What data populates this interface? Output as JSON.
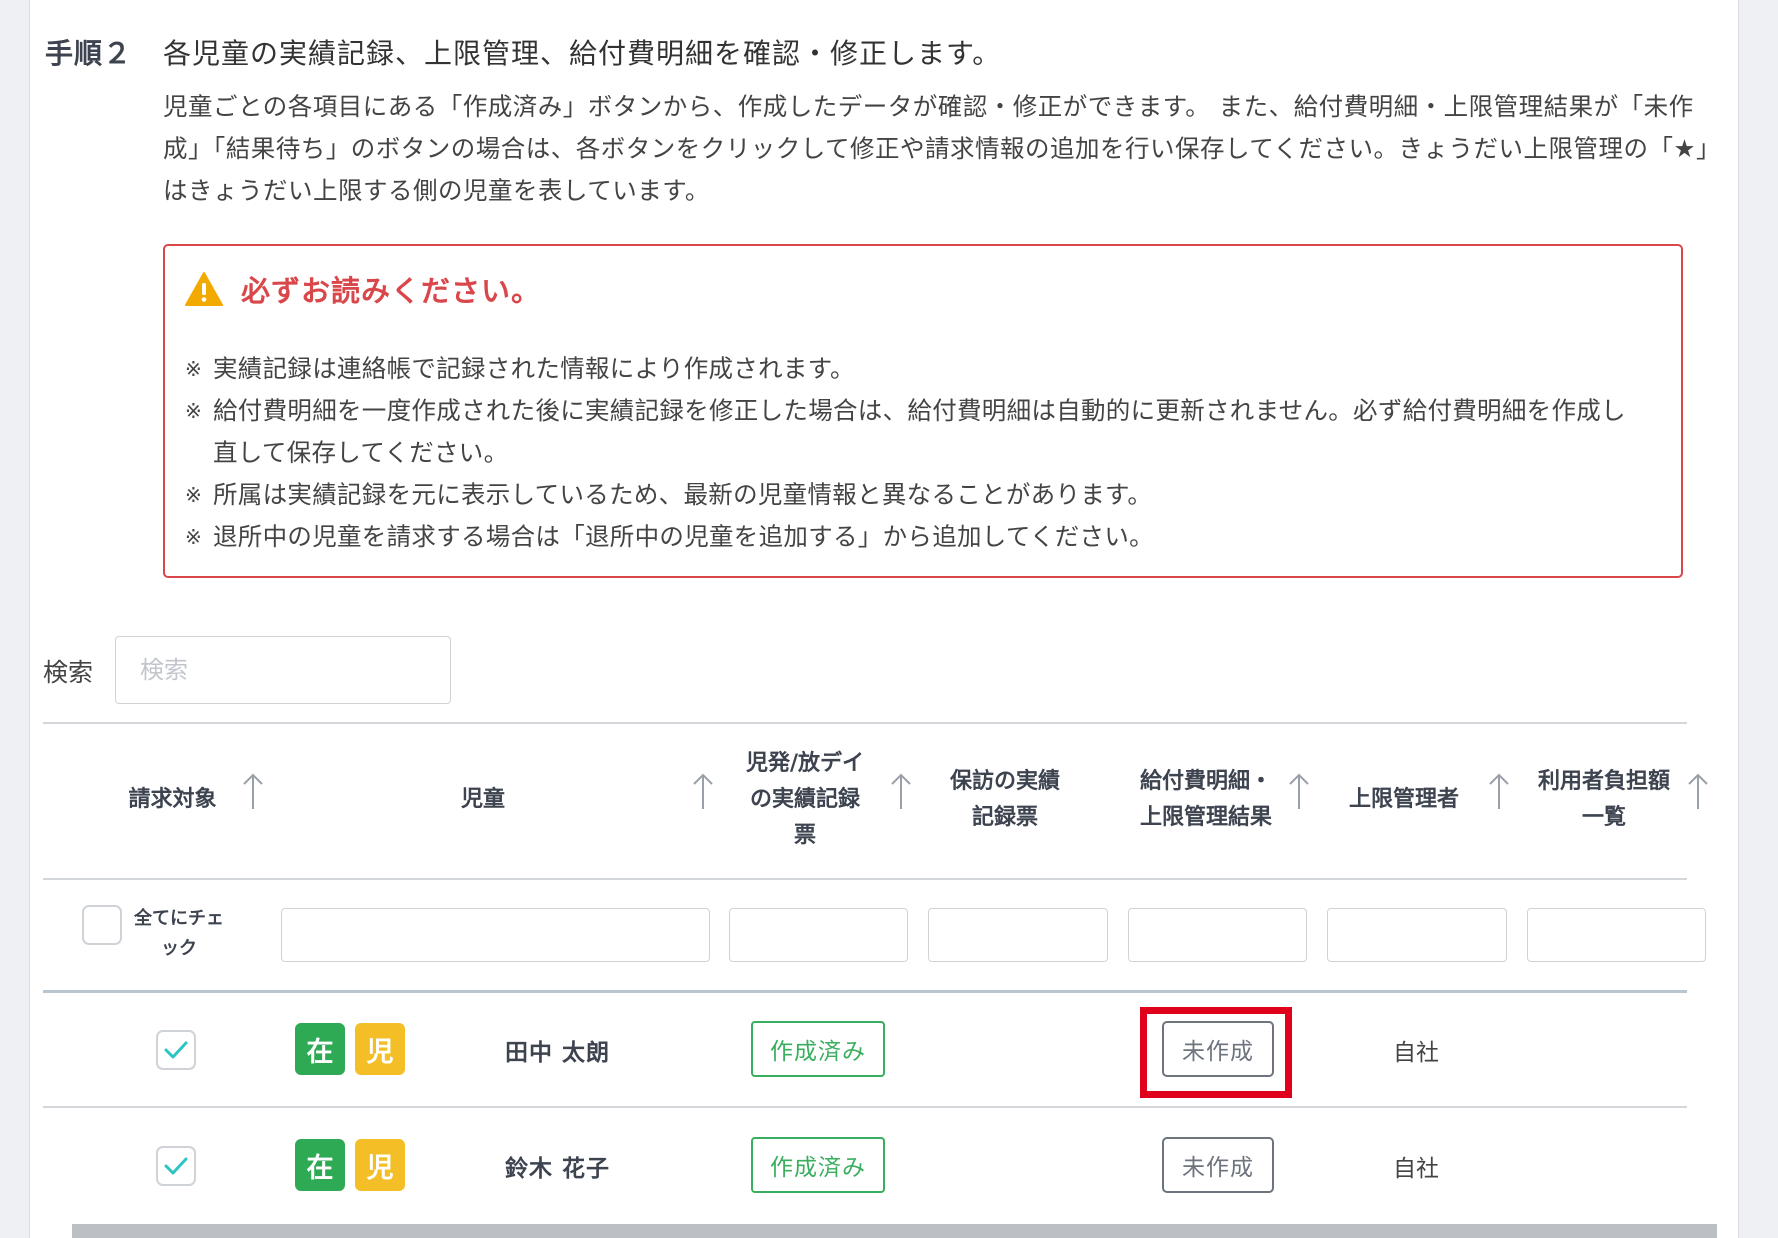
{
  "step": {
    "label": "手順２",
    "title": "各児童の実績記録、上限管理、給付費明細を確認・修正します。",
    "description": "児童ごとの各項目にある「作成済み」ボタンから、作成したデータが確認・修正ができます。 また、給付費明細・上限管理結果が「未作成」「結果待ち」のボタンの場合は、各ボタンをクリックして修正や請求情報の追加を行い保存してください。きょうだい上限管理の「★」はきょうだい上限する側の児童を表しています。"
  },
  "notice": {
    "icon": "warning-icon",
    "title": "必ずお読みください。",
    "mark": "※",
    "items": [
      "実績記録は連絡帳で記録された情報により作成されます。",
      "給付費明細を一度作成された後に実績記録を修正した場合は、給付費明細は自動的に更新されません。必ず給付費明細を作成し直して保存してください。",
      "所属は実績記録を元に表示しているため、最新の児童情報と異なることがあります。",
      "退所中の児童を請求する場合は「退所中の児童を追加する」から追加してください。"
    ],
    "colors": {
      "accent": "#d9474a",
      "warning_fill": "#f2a900"
    }
  },
  "search": {
    "label": "検索",
    "placeholder": "検索",
    "value": ""
  },
  "table": {
    "columns": [
      {
        "label": "請求対象",
        "sortable": true
      },
      {
        "label": "児童",
        "sortable": true
      },
      {
        "label": "児発/放デイの実績記録票",
        "sortable": true
      },
      {
        "label": "保訪の実績記録票",
        "sortable": false
      },
      {
        "label": "給付費明細・上限管理結果",
        "sortable": true
      },
      {
        "label": "上限管理者",
        "sortable": true
      },
      {
        "label": "利用者負担額一覧",
        "sortable": true
      }
    ],
    "check_all_label": "全てにチェック",
    "check_all_checked": false,
    "rows": [
      {
        "checked": true,
        "badges": [
          "在",
          "児"
        ],
        "name": "田中 太朗",
        "record": "作成済み",
        "statement": "未作成",
        "limit_manager": "自社",
        "highlighted": true
      },
      {
        "checked": true,
        "badges": [
          "在",
          "児"
        ],
        "name": "鈴木 花子",
        "record": "作成済み",
        "statement": "未作成",
        "limit_manager": "自社",
        "highlighted": false
      }
    ]
  },
  "colors": {
    "badge_enrolled": "#2eaa55",
    "badge_child": "#f4be26",
    "done_button": "#3aae5f",
    "check": "#2ec4c4",
    "highlight": "#e0001b"
  }
}
